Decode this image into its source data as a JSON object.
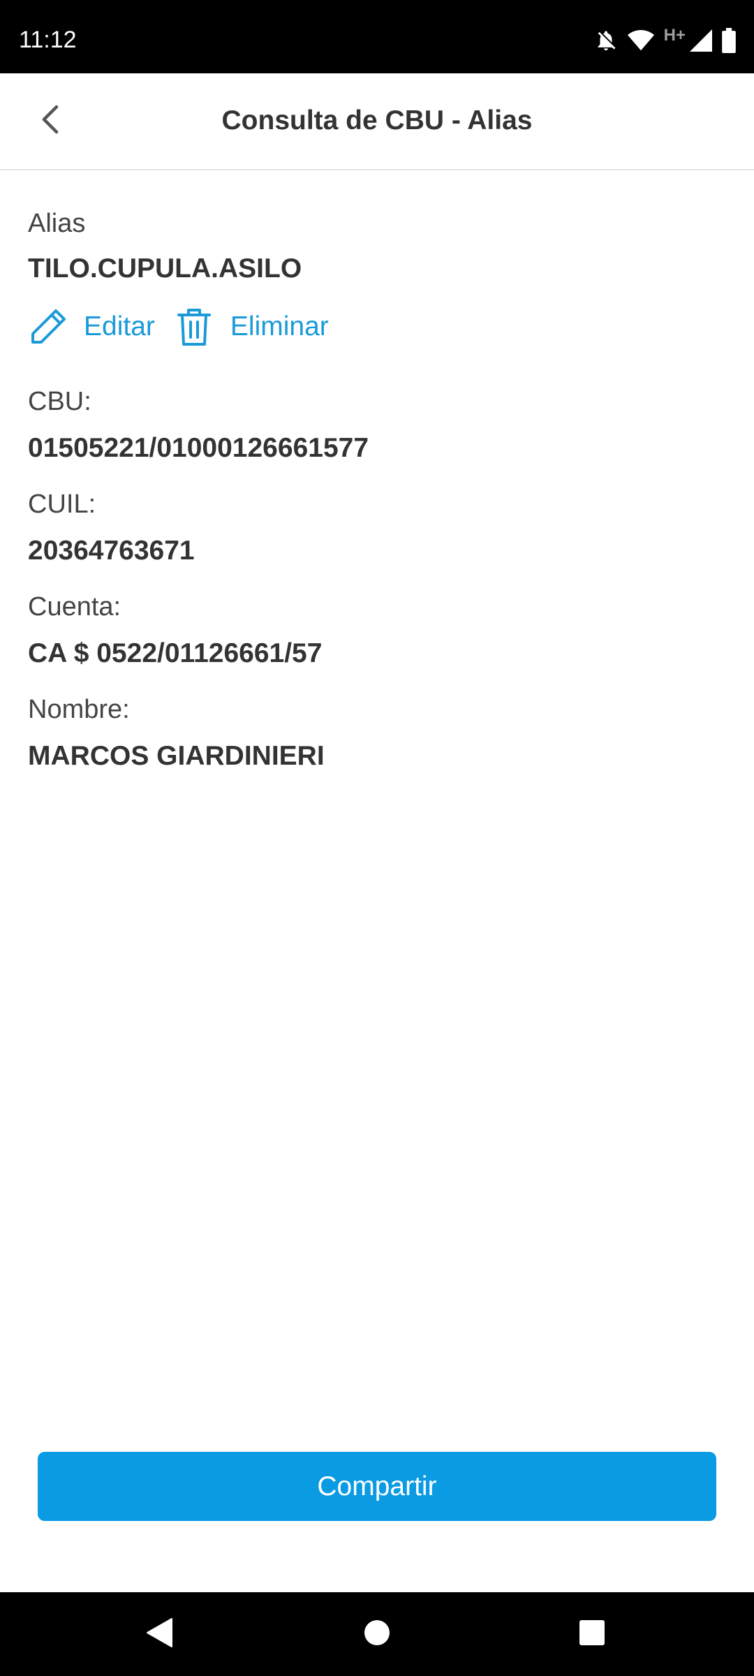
{
  "status_bar": {
    "time": "11:12",
    "network_label": "H+",
    "icons": [
      "notifications-off-icon",
      "wifi-icon",
      "cell-signal-icon",
      "battery-icon"
    ]
  },
  "app_bar": {
    "title": "Consulta de CBU - Alias",
    "back_icon": "chevron-left-icon"
  },
  "alias": {
    "label": "Alias",
    "value": "TILO.CUPULA.ASILO"
  },
  "actions": {
    "edit_label": "Editar",
    "delete_label": "Eliminar"
  },
  "fields": [
    {
      "label": "CBU:",
      "value": "01505221/01000126661577"
    },
    {
      "label": "CUIL:",
      "value": "20364763671"
    },
    {
      "label": "Cuenta:",
      "value": "CA $ 0522/01126661/57"
    },
    {
      "label": "Nombre:",
      "value": "MARCOS GIARDINIERI"
    }
  ],
  "share_button_label": "Compartir",
  "colors": {
    "accent": "#0a9be3",
    "link": "#1a9ad9",
    "text": "#333333"
  },
  "nav_bar": {
    "icons": [
      "back-triangle-icon",
      "home-circle-icon",
      "recents-square-icon"
    ]
  }
}
